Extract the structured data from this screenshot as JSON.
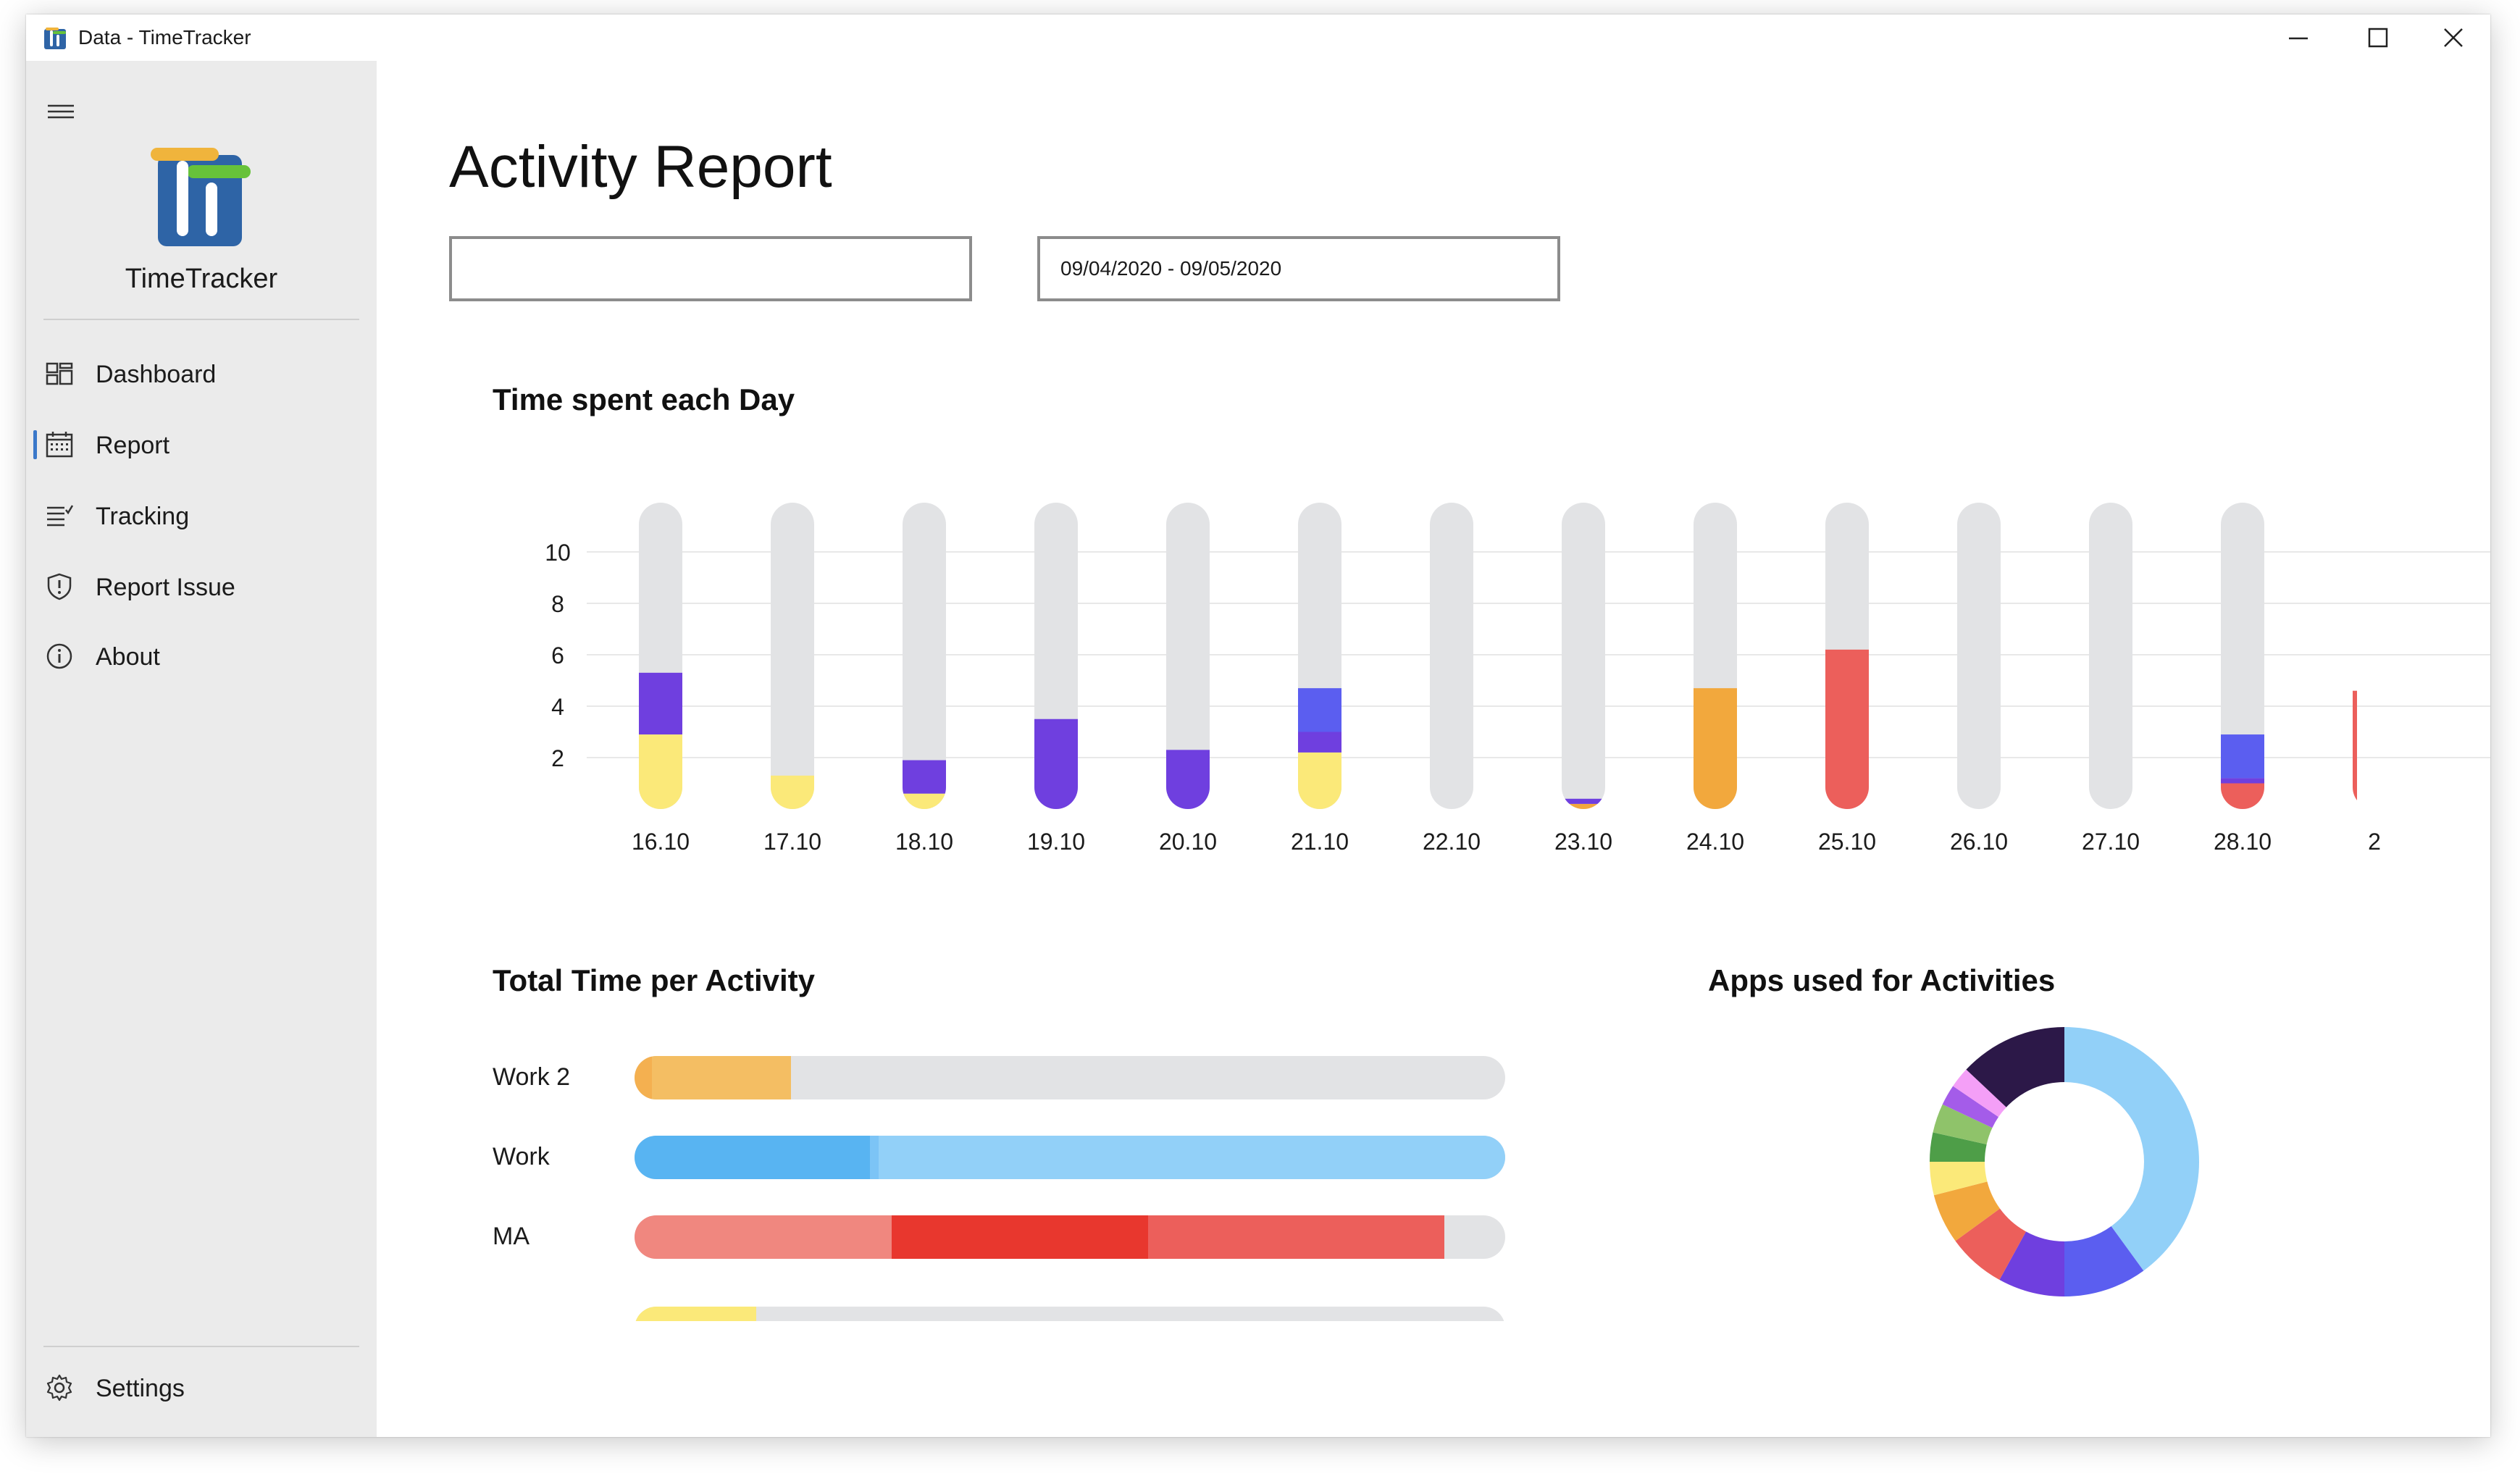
{
  "window": {
    "title": "Data - TimeTracker"
  },
  "sidebar": {
    "brand": "TimeTracker",
    "items": [
      {
        "label": "Dashboard",
        "icon": "dashboard-icon"
      },
      {
        "label": "Report",
        "icon": "calendar-icon",
        "active": true
      },
      {
        "label": "Tracking",
        "icon": "checklist-icon"
      },
      {
        "label": "Report Issue",
        "icon": "shield-icon"
      },
      {
        "label": "About",
        "icon": "info-icon"
      }
    ],
    "settings_label": "Settings"
  },
  "main": {
    "title": "Activity Report",
    "search": {
      "value": ""
    },
    "date_range": {
      "value": "09/04/2020 - 09/05/2020"
    },
    "daily_title": "Time spent each Day",
    "activity_title": "Total Time per Activity",
    "apps_title": "Apps used for Activities"
  },
  "colors": {
    "track": "#e2e3e5",
    "yellow": "#fbe979",
    "purple": "#6f3fdf",
    "blue": "#5b5ef0",
    "orange": "#f2a83d",
    "red": "#ec5f5b",
    "light_blue": "#58b4f2",
    "accent": "#3a78c9"
  },
  "chart_data": [
    {
      "type": "bar",
      "stacked": true,
      "title": "Time spent each Day",
      "categories": [
        "16.10",
        "17.10",
        "18.10",
        "19.10",
        "20.10",
        "21.10",
        "22.10",
        "23.10",
        "24.10",
        "25.10",
        "26.10",
        "27.10",
        "28.10",
        "2"
      ],
      "ylim": [
        0,
        12
      ],
      "yticks": [
        2,
        4,
        6,
        8,
        10
      ],
      "grid": true,
      "series": [
        {
          "color": "#fbe979",
          "values": [
            2.9,
            1.3,
            0.6,
            0,
            0,
            2.2,
            0,
            0,
            0,
            0,
            0,
            0,
            0,
            0
          ]
        },
        {
          "color": "#ec5f5b",
          "values": [
            0,
            0,
            0,
            0,
            0,
            0,
            0,
            0,
            0,
            6.2,
            0,
            0,
            1.0,
            4.6
          ]
        },
        {
          "color": "#f2a83d",
          "values": [
            0,
            0,
            0,
            0,
            0,
            0,
            0,
            0.2,
            4.7,
            0,
            0,
            0,
            0,
            0
          ]
        },
        {
          "color": "#6f3fdf",
          "values": [
            2.4,
            0,
            1.3,
            3.5,
            2.3,
            0.8,
            0,
            0.2,
            0,
            0,
            0,
            0,
            0.2,
            0
          ]
        },
        {
          "color": "#5b5ef0",
          "values": [
            0,
            0,
            0,
            0,
            0,
            1.7,
            0,
            0,
            0,
            0,
            0,
            0,
            1.7,
            0
          ]
        }
      ]
    },
    {
      "type": "bar",
      "orientation": "horizontal",
      "stacked": true,
      "title": "Total Time per Activity",
      "categories": [
        "Work 2",
        "Work",
        "MA"
      ],
      "max": 100,
      "segments": [
        [
          {
            "value": 2,
            "color": "#f4b050"
          },
          {
            "value": 16,
            "color": "#f4be63"
          }
        ],
        [
          {
            "value": 27,
            "color": "#58b4f2"
          },
          {
            "value": 1,
            "color": "#7cc4f6"
          },
          {
            "value": 72,
            "color": "#92d0f8"
          }
        ],
        [
          {
            "value": 29.5,
            "color": "#f0877f"
          },
          {
            "value": 29.5,
            "color": "#e8372e"
          },
          {
            "value": 34,
            "color": "#ec5f5b"
          }
        ]
      ],
      "partial_row": {
        "value": 14,
        "color": "#fbe979"
      }
    },
    {
      "type": "pie",
      "donut": true,
      "title": "Apps used for Activities",
      "slices": [
        {
          "value": 40,
          "color": "#92d0f8"
        },
        {
          "value": 10,
          "color": "#5b5ef0"
        },
        {
          "value": 8,
          "color": "#6f3fdf"
        },
        {
          "value": 7,
          "color": "#ec5f5b"
        },
        {
          "value": 6,
          "color": "#f2a83d"
        },
        {
          "value": 4,
          "color": "#fbe979"
        },
        {
          "value": 3.5,
          "color": "#4e9e48"
        },
        {
          "value": 3.5,
          "color": "#8fc36a"
        },
        {
          "value": 2.5,
          "color": "#a45ce9"
        },
        {
          "value": 2.5,
          "color": "#f49ff7"
        },
        {
          "value": 13,
          "color": "#2c1848"
        }
      ]
    }
  ]
}
